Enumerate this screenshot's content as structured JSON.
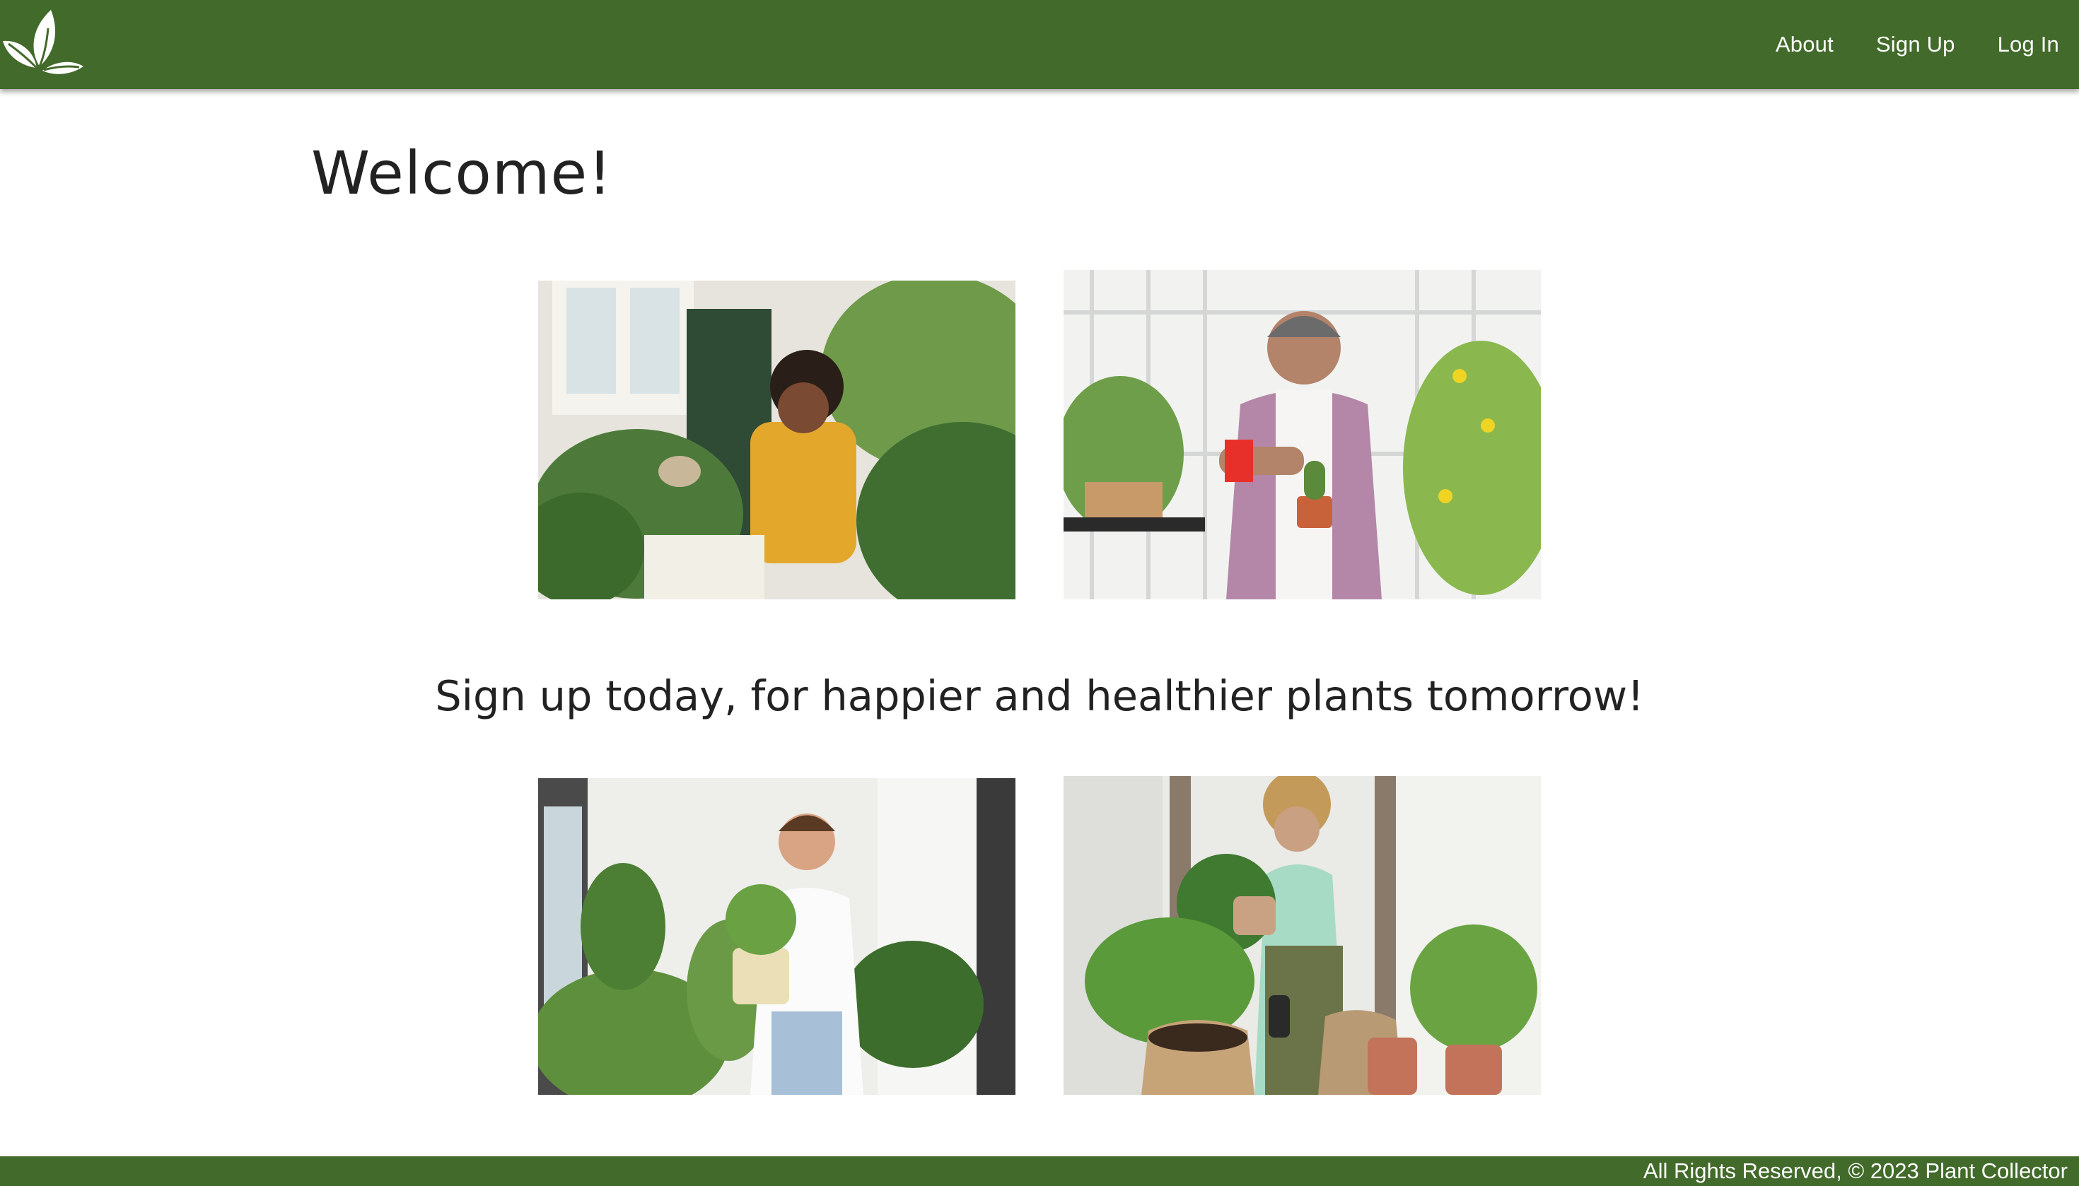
{
  "navbar": {
    "logo_icon": "leaf-logo-icon",
    "links": [
      {
        "label": "About"
      },
      {
        "label": "Sign Up"
      },
      {
        "label": "Log In"
      }
    ]
  },
  "main": {
    "title": "Welcome!",
    "tagline": "Sign up today, for happier and healthier plants tomorrow!",
    "photos": [
      {
        "name": "woman-watering-plants-photo"
      },
      {
        "name": "man-spraying-cactus-photo"
      },
      {
        "name": "man-holding-potted-plant-photo"
      },
      {
        "name": "woman-repotting-plant-photo"
      }
    ]
  },
  "footer": {
    "text": "All Rights Reserved, © 2023 Plant Collector"
  },
  "colors": {
    "brand_green": "#426a2a",
    "text": "#222222",
    "background": "#ffffff"
  }
}
